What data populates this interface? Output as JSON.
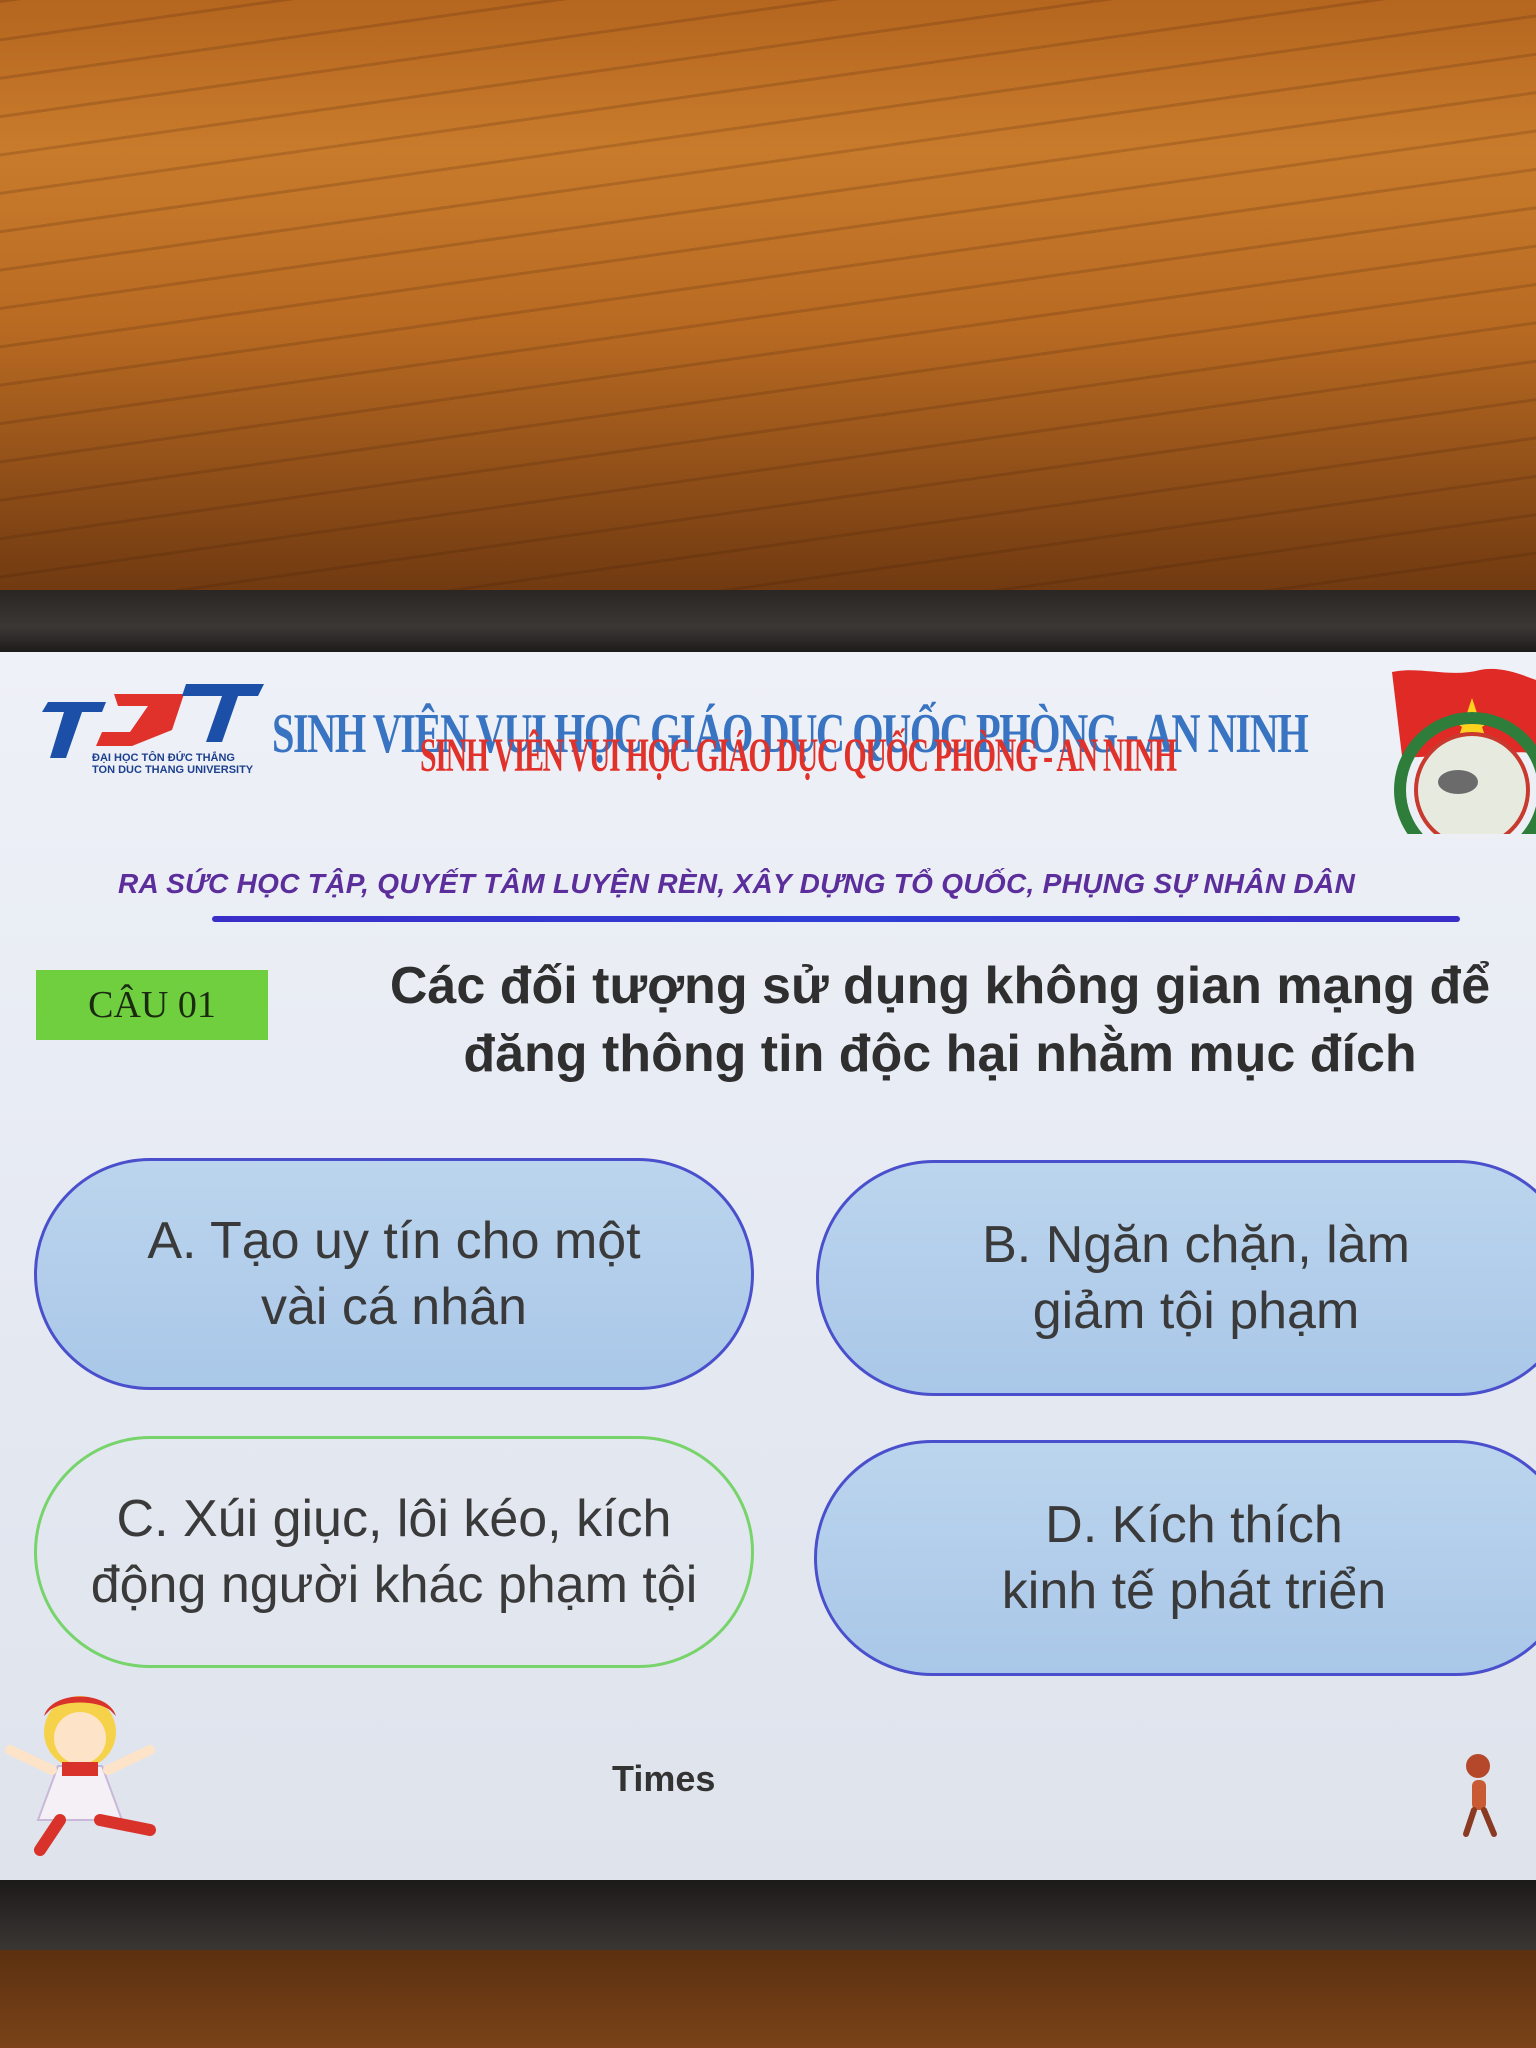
{
  "header": {
    "logo_caption_line1": "ĐẠI HỌC TÔN ĐỨC THẮNG",
    "logo_caption_line2": "TON DUC THANG UNIVERSITY",
    "banner_title_back": "SINH VIÊN VUI HỌC GIÁO DỤC QUỐC PHÒNG - AN NINH",
    "banner_title_front": "SINH VIÊN VUI HỌC GIÁO DỤC QUỐC PHÒNG - AN NINH",
    "slogan": "RA SỨC HỌC TẬP, QUYẾT TÂM LUYỆN RÈN, XÂY DỰNG TỔ QUỐC, PHỤNG SỰ NHÂN DÂN"
  },
  "question": {
    "number_label": "CÂU 01",
    "line1": "Các đối tượng sử dụng không gian mạng để",
    "line2": "đăng thông tin độc hại nhằm mục đích"
  },
  "answers": {
    "a": {
      "line1": "A. Tạo uy tín cho một",
      "line2": "vài cá nhân"
    },
    "b": {
      "line1": "B. Ngăn chặn, làm",
      "line2": "giảm tội phạm"
    },
    "c": {
      "line1": "C. Xúi giục, lôi kéo, kích",
      "line2": "động người khác phạm tội"
    },
    "d": {
      "line1": "D. Kích thích",
      "line2": "kinh tế phát triển"
    }
  },
  "footer": {
    "timer_label": "Times"
  },
  "colors": {
    "badge_green": "#6fcf3e",
    "answer_fill": "#a9c7e8",
    "answer_border": "#4a4fcc",
    "selected_border": "#77d46a",
    "banner_red": "#e0322a",
    "banner_blue": "#2f6ec0",
    "slogan_purple": "#5b2e9c"
  },
  "icons": {
    "logo": "tdt-university-logo",
    "emblem": "youth-union-flag-emblem",
    "mascot": "cartoon-girl-mascot",
    "figure": "small-figure-icon"
  }
}
